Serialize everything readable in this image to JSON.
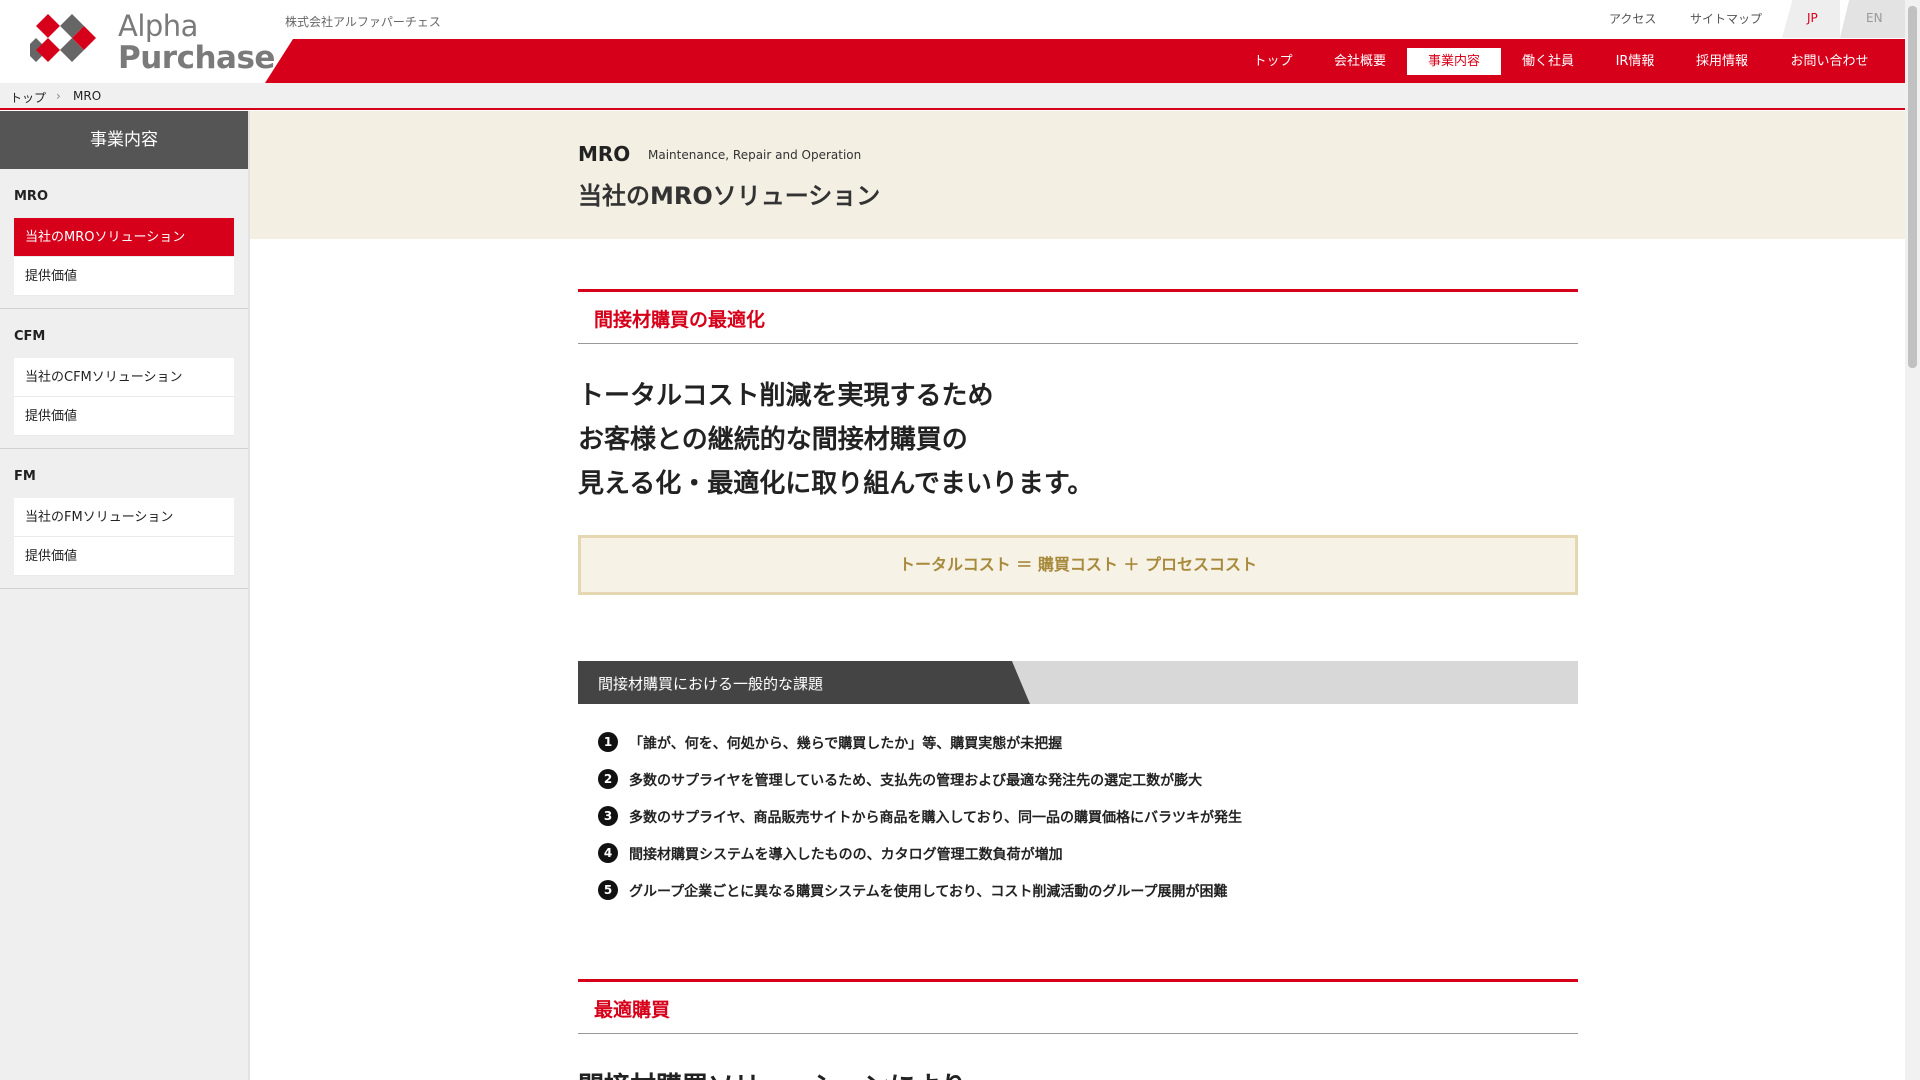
{
  "header": {
    "logo_line1": "Alpha",
    "logo_line2": "Purchase",
    "company": "株式会社アルファパーチェス",
    "util_links": [
      "アクセス",
      "サイトマップ"
    ],
    "lang_jp": "JP",
    "lang_en": "EN",
    "nav": [
      "トップ",
      "会社概要",
      "事業内容",
      "働く社員",
      "IR情報",
      "採用情報",
      "お問い合わせ"
    ],
    "active_nav": "事業内容"
  },
  "breadcrumb": [
    "トップ",
    "MRO"
  ],
  "sidebar": {
    "title": "事業内容",
    "groups": [
      {
        "name": "MRO",
        "items": [
          "当社のMROソリューション",
          "提供価値"
        ]
      },
      {
        "name": "CFM",
        "items": [
          "当社のCFMソリューション",
          "提供価値"
        ]
      },
      {
        "name": "FM",
        "items": [
          "当社のFMソリューション",
          "提供価値"
        ]
      }
    ]
  },
  "hero": {
    "code": "MRO",
    "subtitle": "Maintenance, Repair and Operation",
    "title": "当社のMROソリューション"
  },
  "section1": {
    "heading": "間接材購買の最適化",
    "lead": [
      "トータルコスト削減を実現するため",
      "お客様との継続的な間接材購買の",
      "見える化・最適化に取り組んでまいります。"
    ],
    "formula": "トータルコスト ＝ 購買コスト ＋ プロセスコスト"
  },
  "issues": {
    "heading": "間接材購買における一般的な課題",
    "items": [
      {
        "num": "1",
        "text": "「誰が、何を、何処から、幾らで購買したか」等、購買実態が未把握"
      },
      {
        "num": "2",
        "text": "多数のサプライヤを管理しているため、支払先の管理および最適な発注先の選定工数が膨大"
      },
      {
        "num": "3",
        "text": "多数のサプライヤ、商品販売サイトから商品を購入しており、同一品の購買価格にバラツキが発生"
      },
      {
        "num": "4",
        "text": "間接材購買システムを導入したものの、カタログ管理工数負荷が増加"
      },
      {
        "num": "5",
        "text": "グループ企業ごとに異なる購買システムを使用しており、コスト削減活動のグループ展開が困難"
      }
    ]
  },
  "section2": {
    "heading": "最適購買",
    "cut_text": "間接材購買ソリューションにより"
  }
}
